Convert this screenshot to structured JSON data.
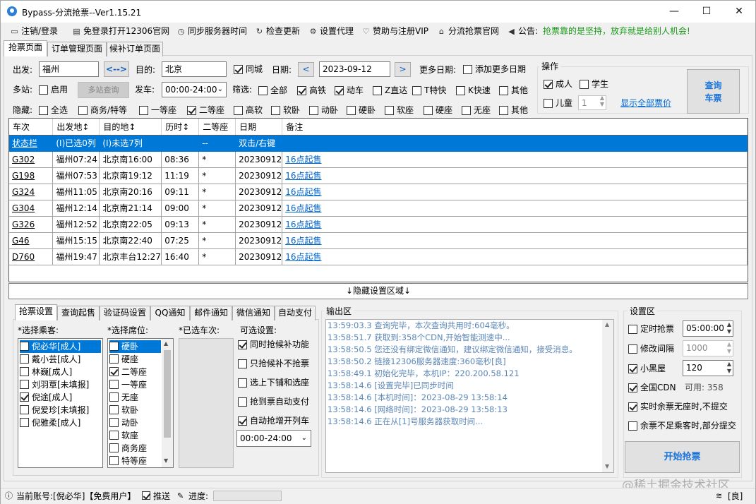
{
  "window": {
    "title": "Bypass-分流抢票--Ver1.15.21",
    "minimize": "—",
    "maximize": "☐",
    "close": "✕"
  },
  "menu": {
    "items": [
      {
        "icon": "login-icon",
        "label": "注销/登录"
      },
      {
        "icon": "browser-icon",
        "label": "免登录打开12306官网"
      },
      {
        "icon": "clock-icon",
        "label": "同步服务器时间"
      },
      {
        "icon": "refresh-icon",
        "label": "检查更新"
      },
      {
        "icon": "gear-icon",
        "label": "设置代理"
      },
      {
        "icon": "heart-icon",
        "label": "赞助与注册VIP"
      },
      {
        "icon": "home-icon",
        "label": "分流抢票官网"
      },
      {
        "icon": "speaker-icon",
        "label": "公告:"
      }
    ],
    "notice": "抢票靠的是坚持，放弃就是给别人机会!"
  },
  "top_tabs": [
    "抢票页面",
    "订单管理页面",
    "候补订单页面"
  ],
  "query": {
    "from_label": "出发:",
    "from_value": "福州",
    "swap_label": "<-->",
    "to_label": "目的:",
    "to_value": "北京",
    "same_city_label": "同城",
    "date_label": "日期:",
    "date_value": "2023-09-12",
    "prev": "<",
    "next": ">",
    "more_dates_label": "更多日期:",
    "add_more_dates": "添加更多日期",
    "multi_station_label": "多站:",
    "enable_label": "启用",
    "multi_query_button": "多站查询",
    "depart_label": "发车:",
    "depart_value": "00:00-24:00",
    "filter_label": "筛选:",
    "filters": [
      {
        "label": "全部",
        "checked": false
      },
      {
        "label": "高铁",
        "checked": true
      },
      {
        "label": "动车",
        "checked": true
      },
      {
        "label": "Z直达",
        "checked": false
      },
      {
        "label": "T特快",
        "checked": false
      },
      {
        "label": "K快速",
        "checked": false
      },
      {
        "label": "其他",
        "checked": false
      }
    ],
    "hide_label": "隐藏:",
    "hide_options": [
      {
        "label": "全选",
        "checked": false
      },
      {
        "label": "商务/特等",
        "checked": false
      },
      {
        "label": "一等座",
        "checked": false
      },
      {
        "label": "二等座",
        "checked": true
      },
      {
        "label": "高软",
        "checked": false
      },
      {
        "label": "软卧",
        "checked": false
      },
      {
        "label": "动卧",
        "checked": false
      },
      {
        "label": "硬卧",
        "checked": false
      },
      {
        "label": "软座",
        "checked": false
      },
      {
        "label": "硬座",
        "checked": false
      },
      {
        "label": "无座",
        "checked": false
      },
      {
        "label": "其他",
        "checked": false
      }
    ]
  },
  "ops": {
    "title": "操作",
    "adult": "成人",
    "student": "学生",
    "child": "儿童",
    "child_count": "1",
    "show_all_prices": "显示全部票价",
    "query_button_line1": "查询",
    "query_button_line2": "车票"
  },
  "grid": {
    "columns": [
      "车次",
      "出发地↕",
      "目的地↕",
      "历时↕",
      "二等座",
      "日期",
      "备注"
    ],
    "status_row": [
      "状态栏",
      "(I)已选0列",
      "(I)未选7列",
      "",
      "--",
      "双击/右键",
      ""
    ],
    "rows": [
      [
        "G302",
        "福州07:24",
        "北京南16:00",
        "08:36",
        "*",
        "20230912",
        "16点起售"
      ],
      [
        "G198",
        "福州07:53",
        "北京南19:12",
        "11:19",
        "*",
        "20230912",
        "16点起售"
      ],
      [
        "G324",
        "福州11:05",
        "北京南20:16",
        "09:11",
        "*",
        "20230912",
        "16点起售"
      ],
      [
        "G304",
        "福州12:14",
        "北京南21:14",
        "09:00",
        "*",
        "20230912",
        "16点起售"
      ],
      [
        "G326",
        "福州12:52",
        "北京南22:05",
        "09:13",
        "*",
        "20230912",
        "16点起售"
      ],
      [
        "G46",
        "福州15:15",
        "北京南22:40",
        "07:25",
        "*",
        "20230912",
        "16点起售"
      ],
      [
        "D760",
        "福州19:47",
        "北京丰台12:27",
        "16:40",
        "*",
        "20230912",
        "16点起售"
      ]
    ]
  },
  "hide_settings": "↓隐藏设置区域↓",
  "bottom_tabs": [
    "抢票设置",
    "查询起售",
    "验证码设置",
    "QQ通知",
    "邮件通知",
    "微信通知",
    "自动支付"
  ],
  "passengers": {
    "label": "*选择乘客:",
    "items": [
      {
        "name": "倪必华[成人]",
        "checked": false,
        "selected": true
      },
      {
        "name": "戴小芸[成人]",
        "checked": false,
        "selected": false
      },
      {
        "name": "林巍[成人]",
        "checked": false,
        "selected": false
      },
      {
        "name": "刘羽覃[未填报]",
        "checked": false,
        "selected": false
      },
      {
        "name": "倪途[成人]",
        "checked": true,
        "selected": false
      },
      {
        "name": "倪爱珍[未填报]",
        "checked": false,
        "selected": false
      },
      {
        "name": "倪雅柔[成人]",
        "checked": false,
        "selected": false
      }
    ]
  },
  "seats": {
    "label": "*选择席位:",
    "items": [
      {
        "name": "硬卧",
        "checked": false,
        "selected": true
      },
      {
        "name": "硬座",
        "checked": false,
        "selected": false
      },
      {
        "name": "二等座",
        "checked": true,
        "selected": false
      },
      {
        "name": "一等座",
        "checked": false,
        "selected": false
      },
      {
        "name": "无座",
        "checked": false,
        "selected": false
      },
      {
        "name": "软卧",
        "checked": false,
        "selected": false
      },
      {
        "name": "动卧",
        "checked": false,
        "selected": false
      },
      {
        "name": "软座",
        "checked": false,
        "selected": false
      },
      {
        "name": "商务座",
        "checked": false,
        "selected": false
      },
      {
        "name": "特等座",
        "checked": false,
        "selected": false
      }
    ]
  },
  "trains_label": "*已选车次:",
  "optional": {
    "label": "可选设置:",
    "items": [
      {
        "label": "同时抢候补功能",
        "checked": true
      },
      {
        "label": "只抢候补不抢票",
        "checked": false
      },
      {
        "label": "选上下铺和选座",
        "checked": false
      },
      {
        "label": "抢到票自动支付",
        "checked": false
      },
      {
        "label": "自动抢增开列车",
        "checked": true
      }
    ],
    "time_value": "00:00-24:00"
  },
  "output": {
    "title": "输出区",
    "lines": [
      "13:59:03.3  查询完毕，本次查询共用时:604毫秒。",
      "13:58:51.7  获取到:358个CDN,开始智能测速中...",
      "13:58:50.5  您还没有绑定微信通知，建议绑定微信通知，接受消息。",
      "13:58:50.2  链接12306服务器速度:360毫秒[良]",
      "13:58:49.1  初始化完毕，本机IP：220.200.58.121",
      "13:58:14.6  [设置完毕]已同步时间",
      "13:58:14.6  [本机时间]：2023-08-29 13:58:14",
      "13:58:14.6  [网络时间]：2023-08-29 13:58:13",
      "13:58:14.6  正在从[1]号服务器获取时间..."
    ]
  },
  "settings": {
    "title": "设置区",
    "timed_label": "定时抢票",
    "timed_value": "05:00:00",
    "interval_label": "修改间隔",
    "interval_value": "1000",
    "blackroom_label": "小黑屋",
    "blackroom_value": "120",
    "cdn_label": "全国CDN",
    "cdn_available": "可用: 358",
    "no_seat_label": "实时余票无座时,不提交",
    "partial_label": "余票不足乘客时,部分提交",
    "start_button": "开始抢票"
  },
  "status": {
    "account": "当前账号:[倪必华]【免费用户】",
    "push": "推送",
    "progress_label": "进度:",
    "progress": 0,
    "network": "[良]"
  },
  "watermark": "@稀土掘金技术社区"
}
